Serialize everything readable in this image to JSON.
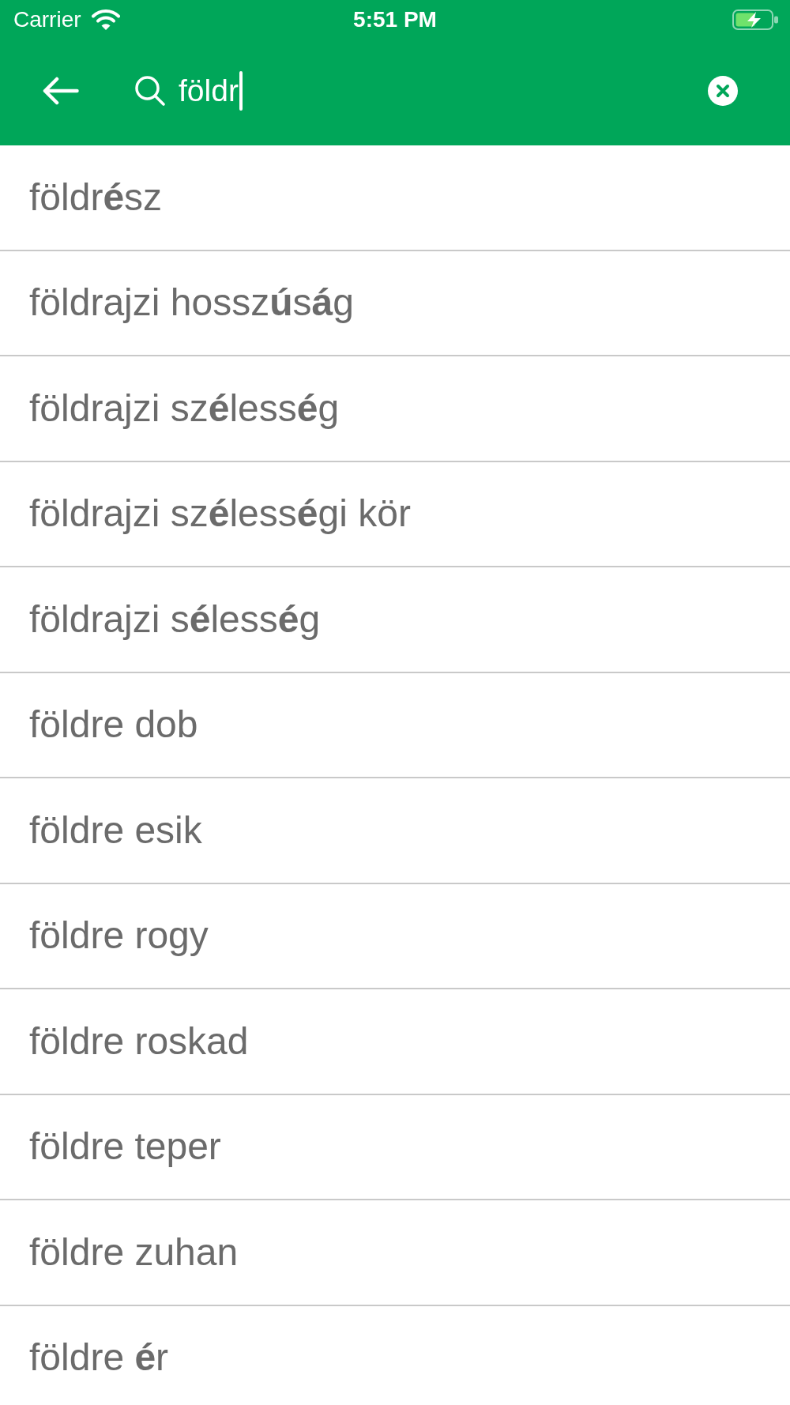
{
  "status_bar": {
    "carrier": "Carrier",
    "time": "5:51 PM"
  },
  "search_bar": {
    "value": "földr",
    "focused": true
  },
  "results": [
    "földr**é**sz",
    "földrajzi hossz**ú**s**á**g",
    "földrajzi sz**é**less**é**g",
    "földrajzi sz**é**less**é**gi kör",
    "földrajzi s**é**less**é**g",
    "földre dob",
    "földre esik",
    "földre rogy",
    "földre roskad",
    "földre teper",
    "földre zuhan",
    "földre **é**r"
  ]
}
